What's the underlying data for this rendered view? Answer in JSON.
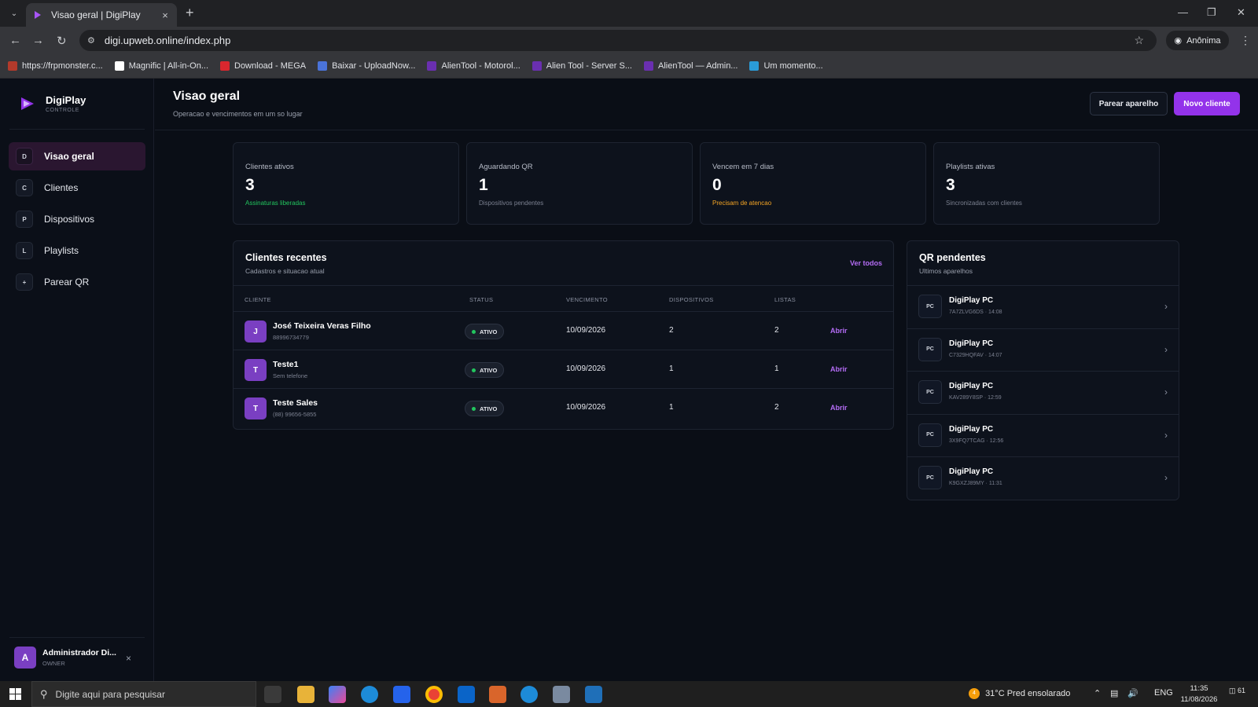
{
  "browser": {
    "tab_title": "Visao geral | DigiPlay",
    "url": "digi.upweb.online/index.php",
    "profile_label": "Anônima",
    "bookmarks": [
      {
        "label": "https://frpmonster.c...",
        "color": "#b33a2b"
      },
      {
        "label": "Magnific | All-in-On...",
        "color": "#ffffff"
      },
      {
        "label": "Download - MEGA",
        "color": "#d9272e"
      },
      {
        "label": "Baixar - UploadNow...",
        "color": "#4a73d9"
      },
      {
        "label": "AlienTool - Motorol...",
        "color": "#6a2fb0"
      },
      {
        "label": "Alien Tool - Server S...",
        "color": "#6a2fb0"
      },
      {
        "label": "AlienTool — Admin...",
        "color": "#6a2fb0"
      },
      {
        "label": "Um momento...",
        "color": "#2a9bd8"
      }
    ]
  },
  "sidebar": {
    "brand_name": "DigiPlay",
    "brand_sub": "CONTROLE",
    "items": [
      {
        "key": "D",
        "label": "Visao geral",
        "active": true
      },
      {
        "key": "C",
        "label": "Clientes"
      },
      {
        "key": "P",
        "label": "Dispositivos"
      },
      {
        "key": "L",
        "label": "Playlists"
      },
      {
        "key": "+",
        "label": "Parear QR"
      }
    ],
    "user": {
      "initial": "A",
      "name": "Administrador Di...",
      "role": "OWNER",
      "close": "×"
    }
  },
  "header": {
    "title": "Visao geral",
    "subtitle": "Operacao e vencimentos em um so lugar",
    "btn_pair": "Parear aparelho",
    "btn_new": "Novo cliente"
  },
  "stats": [
    {
      "label": "Clientes ativos",
      "value": "3",
      "note": "Assinaturas liberadas",
      "note_color": "#22c55e"
    },
    {
      "label": "Aguardando QR",
      "value": "1",
      "note": "Dispositivos pendentes",
      "note_color": "#7b8090"
    },
    {
      "label": "Vencem em 7 dias",
      "value": "0",
      "note": "Precisam de atencao",
      "note_color": "#f5a524"
    },
    {
      "label": "Playlists ativas",
      "value": "3",
      "note": "Sincronizadas com clientes",
      "note_color": "#7b8090"
    }
  ],
  "recent": {
    "title": "Clientes recentes",
    "subtitle": "Cadastros e situacao atual",
    "see_all": "Ver todos",
    "columns": [
      "CLIENTE",
      "STATUS",
      "VENCIMENTO",
      "DISPOSITIVOS",
      "LISTAS"
    ],
    "rows": [
      {
        "initial": "J",
        "name": "José Teixeira Veras Filho",
        "phone": "88996734779",
        "status": "ATIVO",
        "due": "10/09/2026",
        "devices": "2",
        "lists": "2",
        "action": "Abrir"
      },
      {
        "initial": "T",
        "name": "Teste1",
        "phone": "Sem telefone",
        "status": "ATIVO",
        "due": "10/09/2026",
        "devices": "1",
        "lists": "1",
        "action": "Abrir"
      },
      {
        "initial": "T",
        "name": "Teste Sales",
        "phone": "(88) 99656-5855",
        "status": "ATIVO",
        "due": "10/09/2026",
        "devices": "1",
        "lists": "2",
        "action": "Abrir"
      }
    ]
  },
  "qr": {
    "title": "QR pendentes",
    "subtitle": "Ultimos aparelhos",
    "items": [
      {
        "badge": "PC",
        "name": "DigiPlay PC",
        "meta": "7A7ZLVG6DS · 14:08"
      },
      {
        "badge": "PC",
        "name": "DigiPlay PC",
        "meta": "C7329HQFAV · 14:07"
      },
      {
        "badge": "PC",
        "name": "DigiPlay PC",
        "meta": "KAV289Y8SP · 12:59"
      },
      {
        "badge": "PC",
        "name": "DigiPlay PC",
        "meta": "3X9FQ7TCAG · 12:56"
      },
      {
        "badge": "PC",
        "name": "DigiPlay PC",
        "meta": "K9GXZJ89MY · 11:31"
      }
    ]
  },
  "taskbar": {
    "search_placeholder": "Digite aqui para pesquisar",
    "weather": "31°C  Pred ensolarado",
    "lang": "ENG",
    "time": "11:35",
    "date": "11/08/2026",
    "notif_count": "61",
    "weather_badge": "4"
  }
}
